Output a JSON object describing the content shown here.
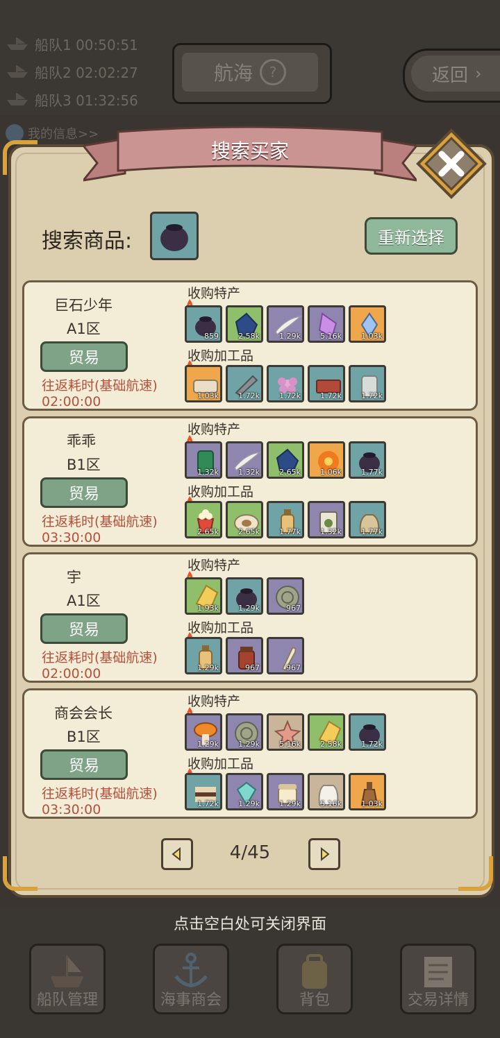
{
  "background": {
    "fleets": [
      "船队1 00:50:51",
      "船队2 02:02:27",
      "船队3 01:32:56"
    ],
    "title": "航海",
    "help_label": "?",
    "back_label": "返回",
    "my_info_label": "我的信息>>"
  },
  "dialog": {
    "title": "搜索买家",
    "search_label": "搜索商品:",
    "reselect_label": "重新选择",
    "pager": {
      "text": "4/45"
    }
  },
  "section_labels": {
    "specialty": "收购特产",
    "processed": "收购加工品"
  },
  "colors": {
    "blue": "#6fa3a6",
    "green": "#8fbf6a",
    "purple": "#8f86b0",
    "orange": "#f0a64a",
    "tan": "#c9b69a"
  },
  "buyers": [
    {
      "name": "巨石少年",
      "zone": "A1区",
      "trade_label": "贸易",
      "trip_label": "往返耗时(基础航速)",
      "trip_time": "02:00:00",
      "specialties": [
        {
          "icon": "dark-pot-icon",
          "qty": "859",
          "bg": "blue"
        },
        {
          "icon": "blue-crystal-icon",
          "qty": "2.58k",
          "bg": "green"
        },
        {
          "icon": "white-feather-icon",
          "qty": "1.29k",
          "bg": "purple"
        },
        {
          "icon": "purple-crystal-icon",
          "qty": "5.16k",
          "bg": "purple"
        },
        {
          "icon": "glowing-gem-icon",
          "qty": "1.03k",
          "bg": "orange"
        }
      ],
      "processed": [
        {
          "icon": "bread-loaf-icon",
          "qty": "1.03k",
          "bg": "orange"
        },
        {
          "icon": "knife-icon",
          "qty": "1.72k",
          "bg": "blue"
        },
        {
          "icon": "pink-flower-icon",
          "qty": "1.72k",
          "bg": "blue"
        },
        {
          "icon": "red-brick-icon",
          "qty": "1.72k",
          "bg": "blue"
        },
        {
          "icon": "glass-jar-icon",
          "qty": "1.72k",
          "bg": "blue"
        }
      ]
    },
    {
      "name": "乖乖",
      "zone": "B1区",
      "trade_label": "贸易",
      "trip_label": "往返耗时(基础航速)",
      "trip_time": "03:30:00",
      "specialties": [
        {
          "icon": "green-gem-icon",
          "qty": "1.32k",
          "bg": "purple"
        },
        {
          "icon": "white-feather-icon",
          "qty": "1.32k",
          "bg": "purple"
        },
        {
          "icon": "blue-crystal-icon",
          "qty": "2.65k",
          "bg": "green"
        },
        {
          "icon": "orange-flower-icon",
          "qty": "1.06k",
          "bg": "orange"
        },
        {
          "icon": "dark-pot-icon",
          "qty": "1.77k",
          "bg": "blue"
        }
      ],
      "processed": [
        {
          "icon": "popcorn-icon",
          "qty": "2.65k",
          "bg": "green"
        },
        {
          "icon": "dumpling-icon",
          "qty": "2.65k",
          "bg": "green"
        },
        {
          "icon": "oil-bottle-icon",
          "qty": "1.77k",
          "bg": "blue"
        },
        {
          "icon": "tea-tin-icon",
          "qty": "1.32k",
          "bg": "purple"
        },
        {
          "icon": "grain-sack-icon",
          "qty": "1.77k",
          "bg": "blue"
        }
      ]
    },
    {
      "name": "宇",
      "zone": "A1区",
      "trade_label": "贸易",
      "trip_label": "往返耗时(基础航速)",
      "trip_time": "02:00:00",
      "specialties": [
        {
          "icon": "yellow-crystal-icon",
          "qty": "1.93k",
          "bg": "green"
        },
        {
          "icon": "dark-pot-icon",
          "qty": "1.29k",
          "bg": "blue"
        },
        {
          "icon": "coin-icon",
          "qty": "967",
          "bg": "purple"
        }
      ],
      "processed": [
        {
          "icon": "oil-bottle-icon",
          "qty": "1.29k",
          "bg": "blue"
        },
        {
          "icon": "sauce-jar-icon",
          "qty": "967",
          "bg": "purple"
        },
        {
          "icon": "bone-icon",
          "qty": "967",
          "bg": "purple"
        }
      ]
    },
    {
      "name": "商会会长",
      "zone": "B1区",
      "trade_label": "贸易",
      "trip_label": "往返耗时(基础航速)",
      "trip_time": "03:30:00",
      "specialties": [
        {
          "icon": "mushroom-icon",
          "qty": "1.29k",
          "bg": "purple"
        },
        {
          "icon": "coin-icon",
          "qty": "1.29k",
          "bg": "purple"
        },
        {
          "icon": "starfish-icon",
          "qty": "5.16k",
          "bg": "tan"
        },
        {
          "icon": "yellow-crystal-icon",
          "qty": "2.58k",
          "bg": "green"
        },
        {
          "icon": "dark-pot-icon",
          "qty": "1.72k",
          "bg": "blue"
        }
      ],
      "processed": [
        {
          "icon": "sandwich-icon",
          "qty": "1.72k",
          "bg": "blue"
        },
        {
          "icon": "teal-gem-icon",
          "qty": "1.29k",
          "bg": "purple"
        },
        {
          "icon": "cream-jar-icon",
          "qty": "1.29k",
          "bg": "purple"
        },
        {
          "icon": "flour-sack-icon",
          "qty": "5.16k",
          "bg": "tan"
        },
        {
          "icon": "potion-bottle-icon",
          "qty": "1.03k",
          "bg": "orange"
        }
      ]
    }
  ],
  "close_hint": "点击空白处可关闭界面",
  "bottom_nav": [
    {
      "label": "船队管理",
      "icon": "ship-icon"
    },
    {
      "label": "海事商会",
      "icon": "anchor-icon"
    },
    {
      "label": "背包",
      "icon": "backpack-icon"
    },
    {
      "label": "交易详情",
      "icon": "scroll-icon"
    }
  ]
}
